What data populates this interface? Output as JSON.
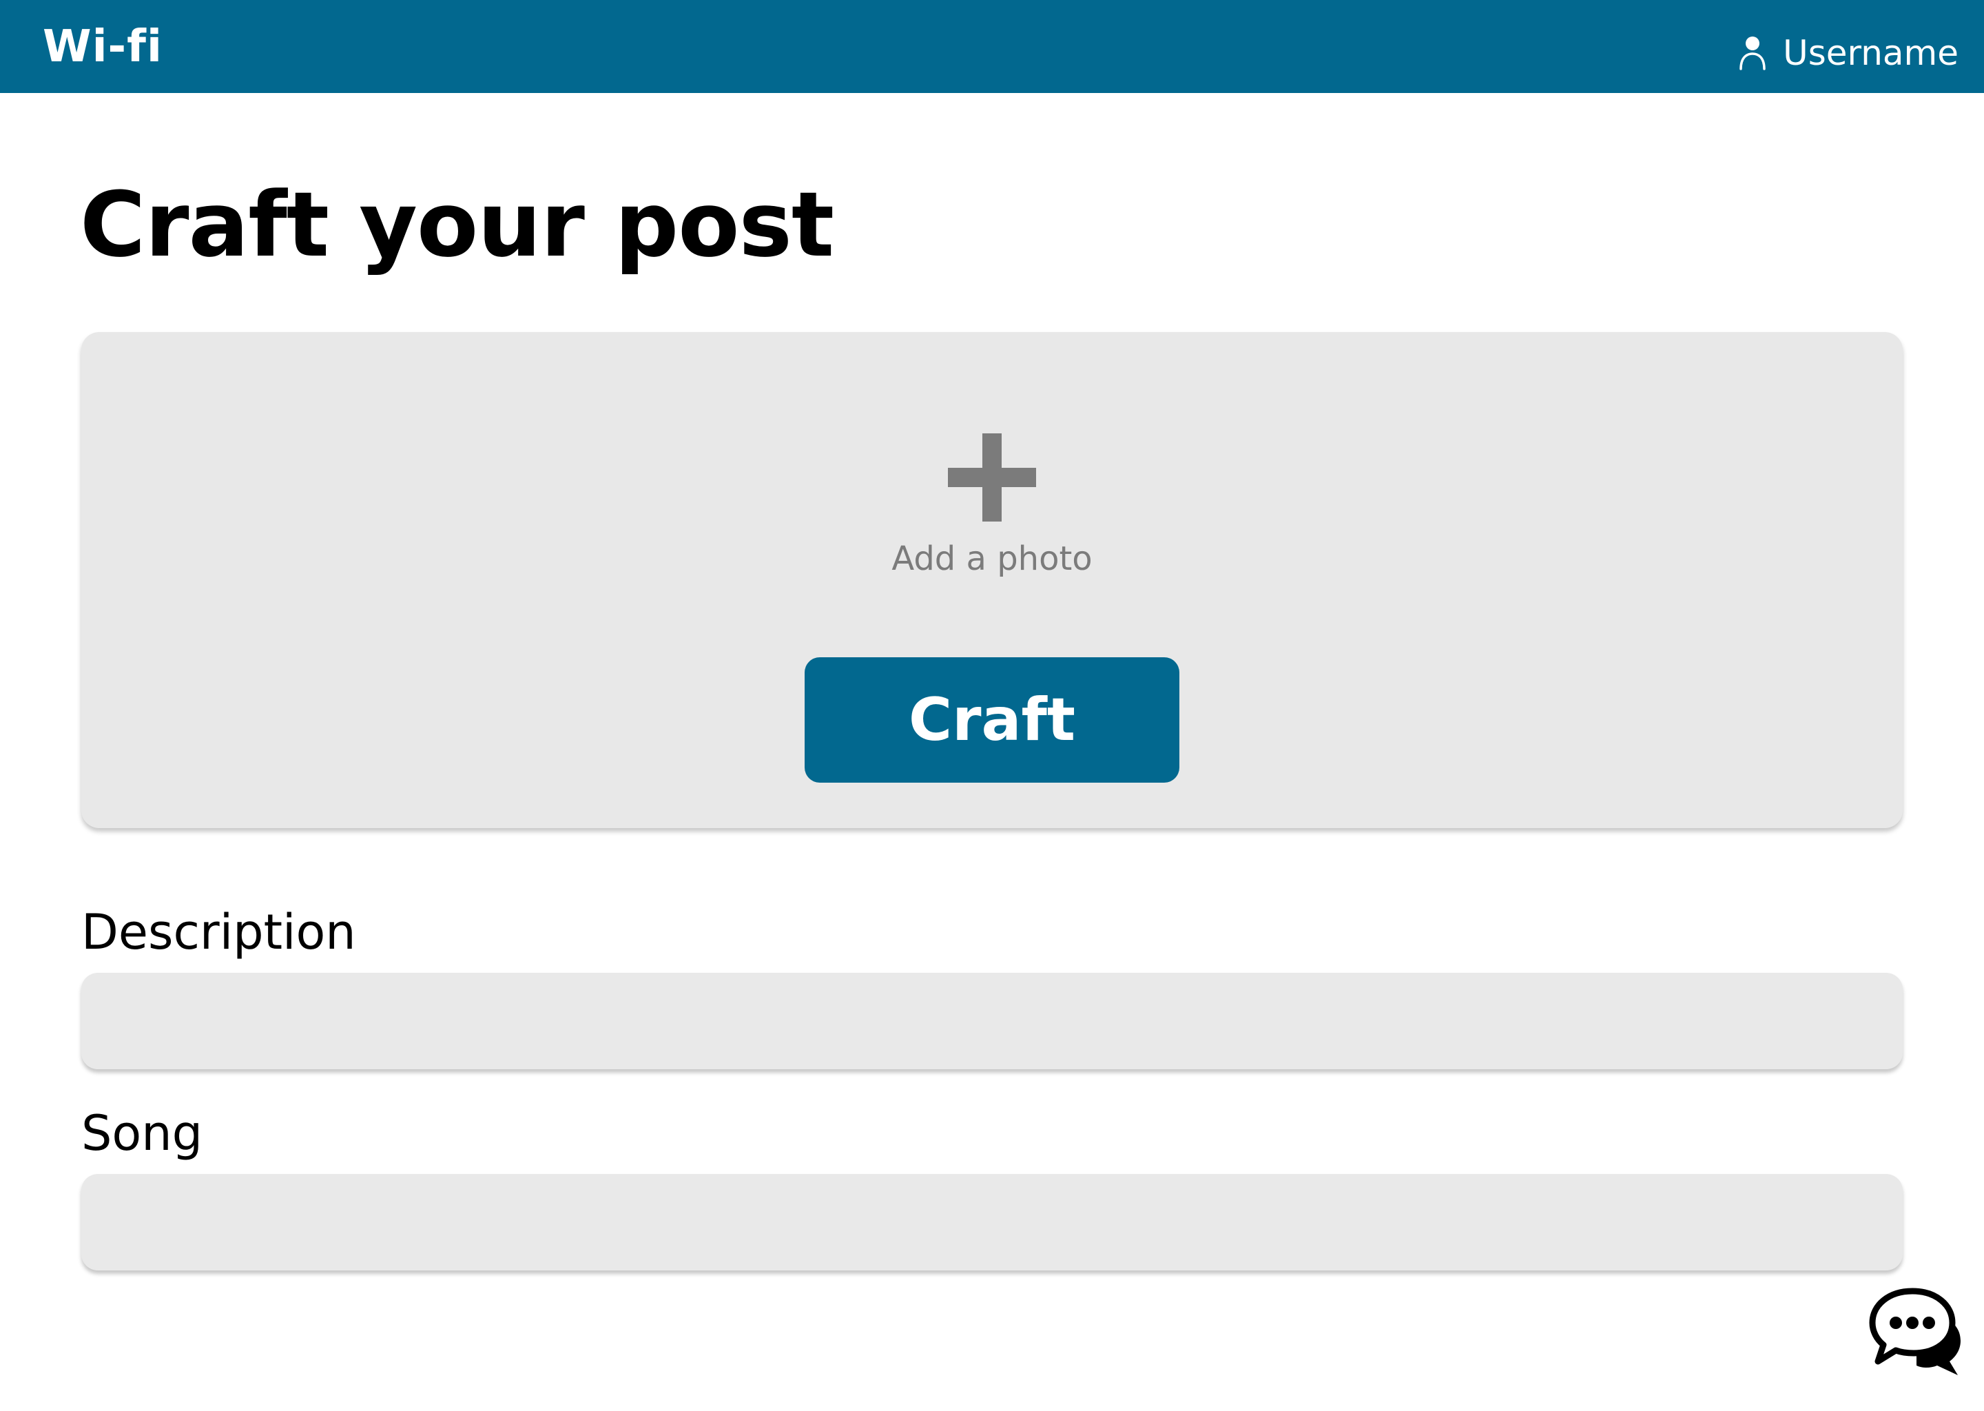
{
  "header": {
    "brand": "Wi-fi",
    "username": "Username",
    "user_icon": "user-icon"
  },
  "page": {
    "title": "Craft your post"
  },
  "photo_panel": {
    "add_icon": "plus-icon",
    "add_label": "Add a photo",
    "craft_label": "Craft"
  },
  "form": {
    "description_label": "Description",
    "description_value": "",
    "song_label": "Song",
    "song_value": ""
  },
  "chat": {
    "icon": "chat-bubbles-icon"
  },
  "colors": {
    "primary": "#02688f",
    "panel": "#e8e8e8",
    "muted_text": "#7b7b7b"
  }
}
